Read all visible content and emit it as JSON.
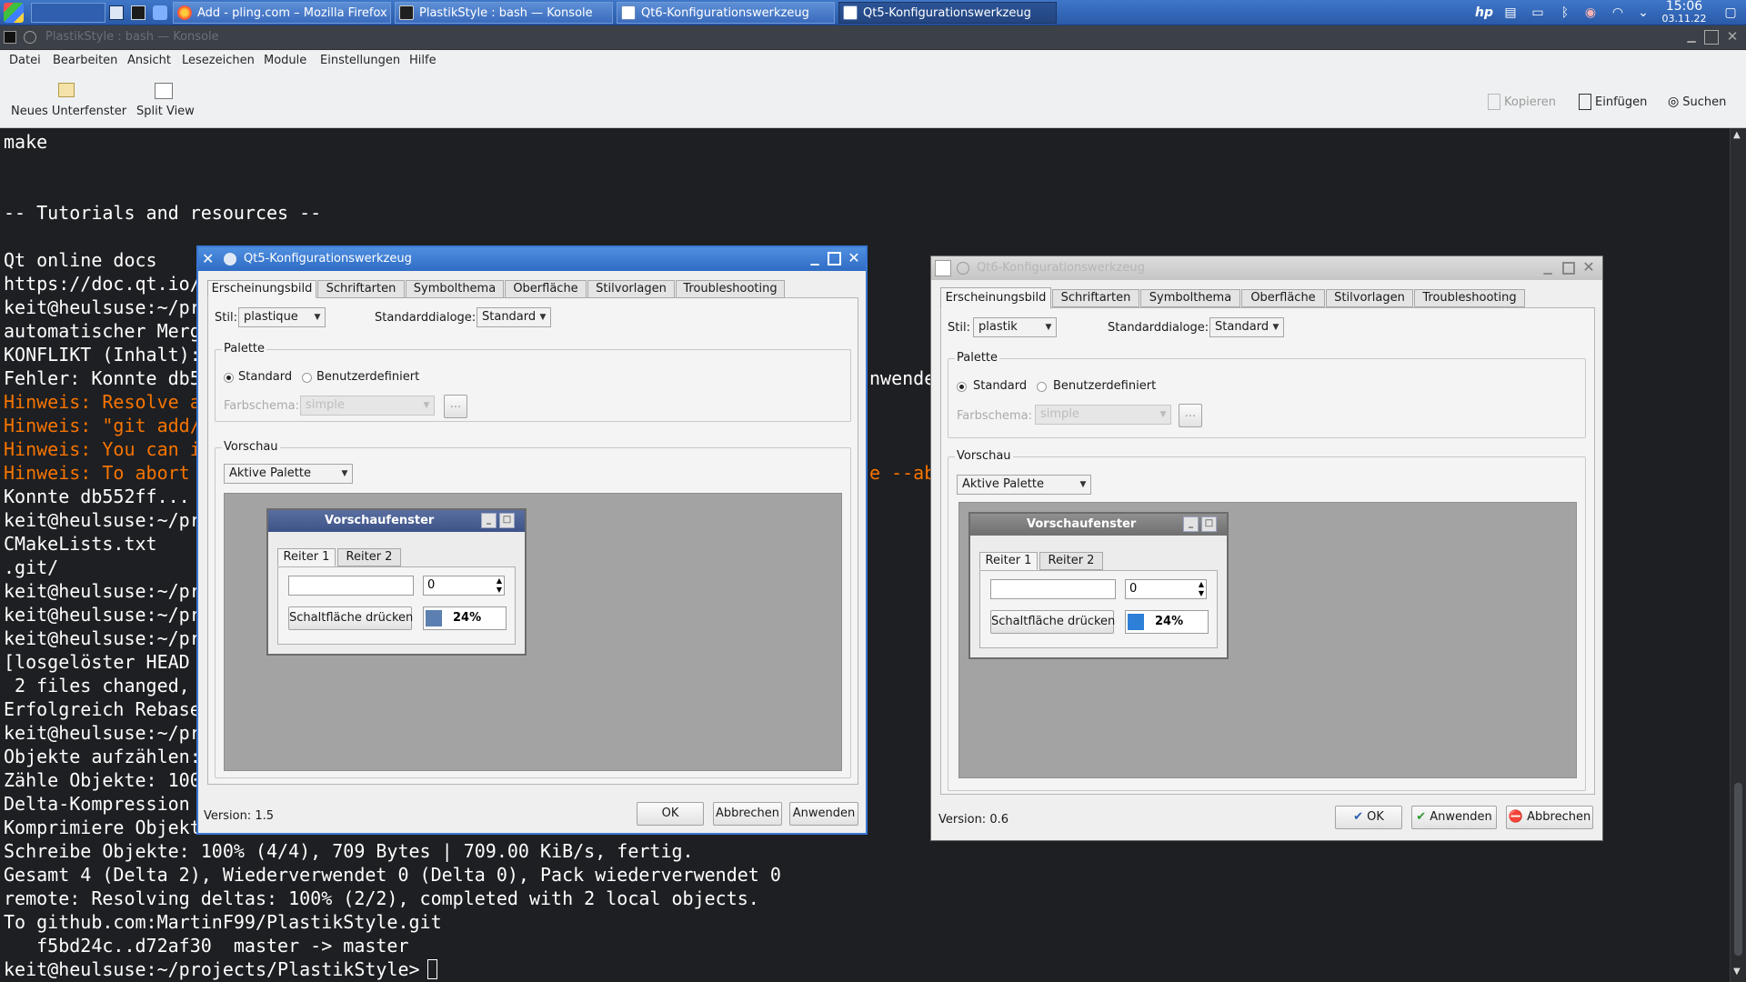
{
  "taskbar": {
    "tasks": [
      {
        "label": "Add - pling.com – Mozilla Firefox",
        "active": false
      },
      {
        "label": "PlastikStyle : bash — Konsole",
        "active": false
      },
      {
        "label": "Qt6-Konfigurationswerkzeug",
        "active": false
      },
      {
        "label": "Qt5-Konfigurationswerkzeug",
        "active": true
      }
    ],
    "clock": {
      "time": "15:06",
      "date": "03.11.22"
    },
    "icons": [
      "start-menu-icon",
      "desktop-icon",
      "terminal-icon",
      "app-icon",
      "monitor-icon",
      "hp-icon",
      "clipboard-icon",
      "battery-icon",
      "bluetooth-icon",
      "volume-muted-icon",
      "wifi-icon",
      "updates-icon",
      "show-desktop-icon"
    ]
  },
  "konsole": {
    "title": "PlastikStyle : bash — Konsole",
    "menu": [
      "Datei",
      "Bearbeiten",
      "Ansicht",
      "Lesezeichen",
      "Module",
      "Einstellungen",
      "Hilfe"
    ],
    "toolbar": {
      "new_tab": "Neues Unterfenster",
      "split_view": "Split View",
      "copy": "Kopieren",
      "paste": "Einfügen",
      "find": "Suchen"
    },
    "lines": [
      {
        "text": "make",
        "color": "white"
      },
      {
        "text": "",
        "color": "white"
      },
      {
        "text": "",
        "color": "white"
      },
      {
        "text": "-- Tutorials and resources --",
        "color": "white"
      },
      {
        "text": "",
        "color": "white"
      },
      {
        "text": "Qt online docs",
        "color": "white"
      },
      {
        "text": "https://doc.qt.io/",
        "color": "white"
      },
      {
        "text": "keit@heulsuse:~/pr",
        "color": "white"
      },
      {
        "text": "automatischer Merg",
        "color": "white"
      },
      {
        "text": "KONFLIKT (Inhalt):",
        "color": "white"
      },
      {
        "text": "Fehler: Konnte db5",
        "color": "white"
      },
      {
        "text": "Hinweis: Resolve a",
        "color": "orange"
      },
      {
        "text": "Hinweis: \"git add/",
        "color": "orange"
      },
      {
        "text": "Hinweis: You can i",
        "color": "orange"
      },
      {
        "text": "Hinweis: To abort",
        "color": "orange"
      },
      {
        "text": "Konnte db552ff...",
        "color": "white"
      },
      {
        "text": "keit@heulsuse:~/pr",
        "color": "white"
      },
      {
        "text": "CMakeLists.txt",
        "color": "white"
      },
      {
        "text": ".git/",
        "color": "white"
      },
      {
        "text": "keit@heulsuse:~/pr",
        "color": "white"
      },
      {
        "text": "keit@heulsuse:~/pr",
        "color": "white"
      },
      {
        "text": "keit@heulsuse:~/pr",
        "color": "white"
      },
      {
        "text": "[losgelöster HEAD",
        "color": "white"
      },
      {
        "text": " 2 files changed,",
        "color": "white"
      },
      {
        "text": "Erfolgreich Rebase",
        "color": "white"
      },
      {
        "text": "keit@heulsuse:~/pr",
        "color": "white"
      },
      {
        "text": "Objekte aufzählen:",
        "color": "white"
      },
      {
        "text": "Zähle Objekte: 100",
        "color": "white"
      },
      {
        "text": "Delta-Kompression",
        "color": "white"
      },
      {
        "text": "Komprimiere Objekt",
        "color": "white"
      },
      {
        "text": "Schreibe Objekte: 100% (4/4), 709 Bytes | 709.00 KiB/s, fertig.",
        "color": "white"
      },
      {
        "text": "Gesamt 4 (Delta 2), Wiederverwendet 0 (Delta 0), Pack wiederverwendet 0",
        "color": "white"
      },
      {
        "text": "remote: Resolving deltas: 100% (2/2), completed with 2 local objects.",
        "color": "white"
      },
      {
        "text": "To github.com:MartinF99/PlastikStyle.git",
        "color": "white"
      },
      {
        "text": "   f5bd24c..d72af30  master -> master",
        "color": "white"
      },
      {
        "text": "keit@heulsuse:~/projects/PlastikStyle> ",
        "color": "white"
      }
    ],
    "right_fragments": [
      {
        "text": "nwende",
        "row": 10,
        "color": "white"
      },
      {
        "text": "e --ab",
        "row": 14,
        "color": "orange"
      }
    ]
  },
  "qt5": {
    "title": "Qt5-Konfigurationswerkzeug",
    "tabs": [
      "Erscheinungsbild",
      "Schriftarten",
      "Symbolthema",
      "Oberfläche",
      "Stilvorlagen",
      "Troubleshooting"
    ],
    "style_label": "Stil:",
    "style_value": "plastique",
    "dialogs_label": "Standarddialoge:",
    "dialogs_value": "Standard",
    "palette_group": "Palette",
    "radio_standard": "Standard",
    "radio_custom": "Benutzerdefiniert",
    "scheme_label": "Farbschema:",
    "scheme_value": "simple",
    "dots": "...",
    "preview_group": "Vorschau",
    "preview_combo": "Aktive Palette",
    "preview_title": "Vorschaufenster",
    "tab1": "Reiter 1",
    "tab2": "Reiter 2",
    "spin_value": "0",
    "push_button": "Schaltfläche drücken",
    "progress": "24%",
    "version": "Version: 1.5",
    "ok": "OK",
    "cancel": "Abbrechen",
    "apply": "Anwenden"
  },
  "qt6": {
    "title": "Qt6-Konfigurationswerkzeug",
    "tabs": [
      "Erscheinungsbild",
      "Schriftarten",
      "Symbolthema",
      "Oberfläche",
      "Stilvorlagen",
      "Troubleshooting"
    ],
    "style_label": "Stil:",
    "style_value": "plastik",
    "dialogs_label": "Standarddialoge:",
    "dialogs_value": "Standard",
    "palette_group": "Palette",
    "radio_standard": "Standard",
    "radio_custom": "Benutzerdefiniert",
    "scheme_label": "Farbschema:",
    "scheme_value": "simple",
    "dots": "...",
    "preview_group": "Vorschau",
    "preview_combo": "Aktive Palette",
    "preview_title": "Vorschaufenster",
    "tab1": "Reiter 1",
    "tab2": "Reiter 2",
    "spin_value": "0",
    "push_button": "Schaltfläche drücken",
    "progress": "24%",
    "version": "Version: 0.6",
    "ok": "OK",
    "apply": "Anwenden",
    "cancel": "Abbrechen"
  },
  "colors": {
    "terminal_bg": "#1e1f22",
    "terminal_orange": "#f67400",
    "taskbar": "#3567b8",
    "progress_blue": "#2e7fd8"
  }
}
